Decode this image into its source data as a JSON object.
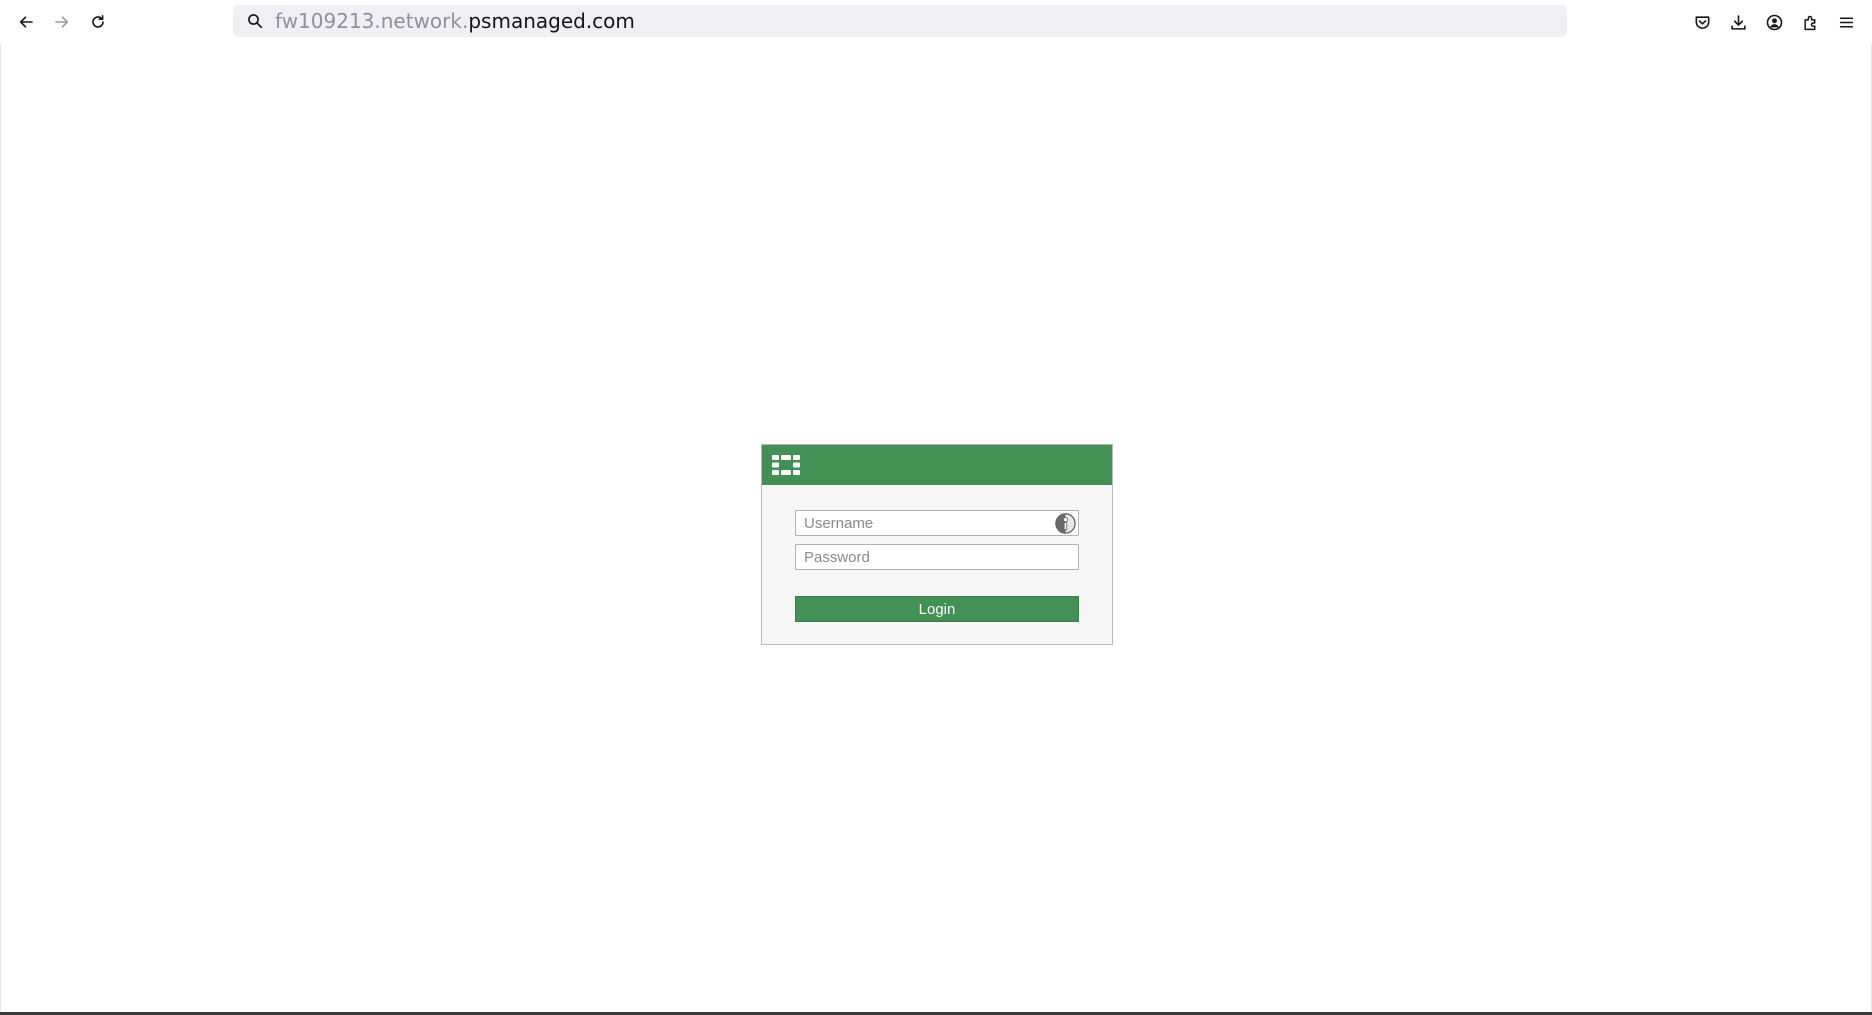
{
  "browser": {
    "back_icon": "arrow-left-icon",
    "forward_icon": "arrow-right-icon",
    "reload_icon": "reload-icon",
    "url_prefix": "fw109213.network.",
    "url_domain": "psmanaged.com",
    "right_icons": [
      "pocket-icon",
      "download-icon",
      "account-icon",
      "extensions-icon",
      "menu-icon"
    ]
  },
  "login": {
    "header_color": "#439055",
    "logo_icon": "fortinet-logo",
    "username_placeholder": "Username",
    "password_placeholder": "Password",
    "cert_icon": "certificate-login-icon",
    "login_label": "Login"
  }
}
